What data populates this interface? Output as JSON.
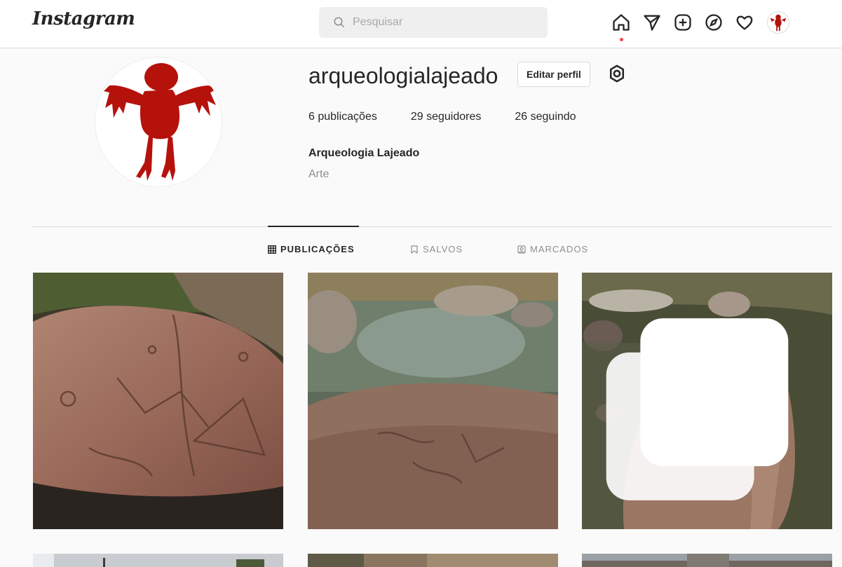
{
  "topbar": {
    "logo": "Instagram",
    "search_placeholder": "Pesquisar"
  },
  "profile": {
    "username": "arqueologialajeado",
    "edit_label": "Editar perfil",
    "stats": {
      "posts_count": "6",
      "posts_label": " publicações",
      "followers_count": "29",
      "followers_label": " seguidores",
      "following_count": "26",
      "following_label": " seguindo"
    },
    "full_name": "Arqueologia Lajeado",
    "category": "Arte"
  },
  "tabs": [
    {
      "label": "PUBLICAÇÕES",
      "icon": "grid-icon"
    },
    {
      "label": "SALVOS",
      "icon": "bookmark-icon"
    },
    {
      "label": "MARCADOS",
      "icon": "tagged-icon"
    }
  ],
  "icons": {
    "nav": [
      "home-icon",
      "direct-icon",
      "new-post-icon",
      "explore-icon",
      "activity-icon"
    ],
    "settings": "settings-icon"
  },
  "colors": {
    "accent_red": "#b5120c",
    "notification_dot": "#ed4956",
    "border": "#dbdbdb",
    "muted_text": "#8e8e8e"
  }
}
